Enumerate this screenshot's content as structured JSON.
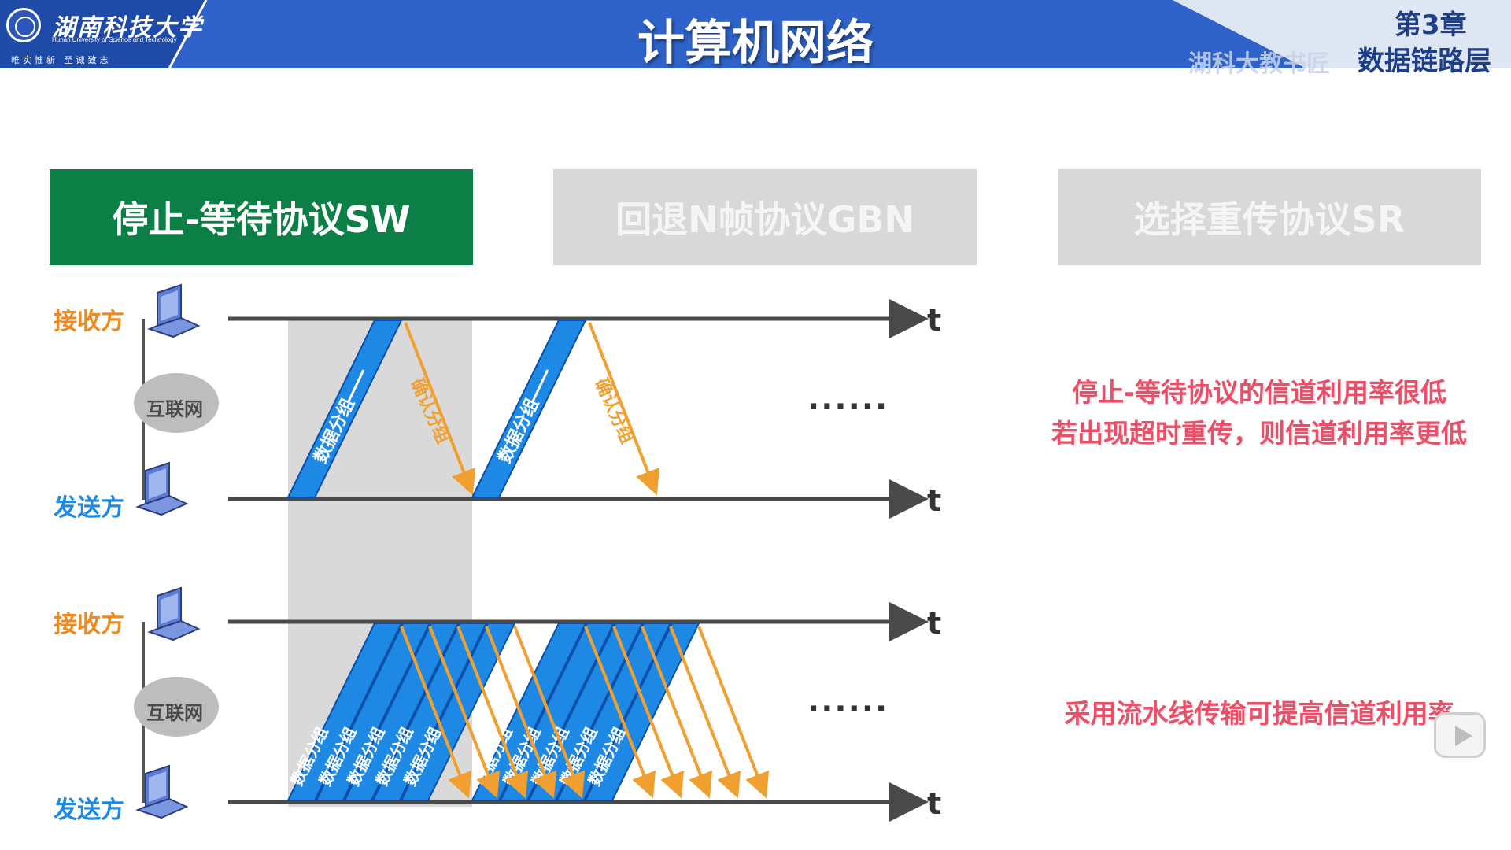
{
  "header": {
    "logo_cn": "湖南科技大学",
    "logo_en": "Hunan University of Science and Technology",
    "logo_motto": "唯实惟新  至诚致志",
    "title": "计算机网络",
    "chapter": "第3章",
    "chapter_sub": "数据链路层",
    "school": "湖科大教书匠",
    "colors": {
      "bar": "#2f63c9",
      "bar_dark": "#1e4aa8"
    }
  },
  "tabs": [
    {
      "label": "停止-等待协议SW",
      "state": "active"
    },
    {
      "label": "回退N帧协议GBN",
      "state": "inactive"
    },
    {
      "label": "选择重传协议SR",
      "state": "inactive"
    }
  ],
  "diagram": {
    "receiver_label": "接收方",
    "sender_label": "发送方",
    "cloud_label": "互联网",
    "time_label": "t",
    "data_packet_label": "数据分组",
    "ack_label": "确认分组",
    "ellipsis": "......",
    "colors": {
      "data": "#1e88e5",
      "ack": "#f0a030",
      "axis": "#4a4a4a",
      "shade": "#d9d9d9"
    }
  },
  "notes": {
    "line1": "停止-等待协议的信道利用率很低",
    "line2": "若出现超时重传，则信道利用率更低",
    "line3": "采用流水线传输可提高信道利用率"
  }
}
